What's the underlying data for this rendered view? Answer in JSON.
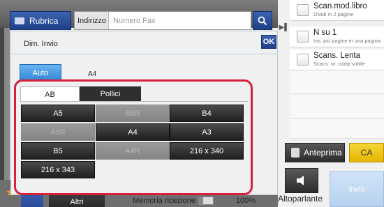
{
  "topbar": {
    "rubrica_label": "Rubrica",
    "indirizzo_label": "Indirizzo",
    "fax_placeholder": "Numero Fax"
  },
  "right_panel": {
    "options": [
      {
        "title": "Scan.mod.libro",
        "subtitle": "Dividi in 2 pagine"
      },
      {
        "title": "N su 1",
        "subtitle": "Ins. più pagine in una pagina"
      },
      {
        "title": "Scans. Lenta",
        "subtitle": "Scans. or. carta sottile"
      }
    ],
    "preview_label": "Anteprima",
    "ca_label": "CA",
    "speaker_label": "Altoparlante",
    "send_label": "Invio"
  },
  "dialog": {
    "title": "Dim. Invio",
    "ok_label": "OK",
    "auto_label": "Auto",
    "auto_value": "A4",
    "tabs": [
      "AB",
      "Pollici"
    ],
    "sizes": [
      {
        "label": "A5",
        "enabled": true
      },
      {
        "label": "B5R",
        "enabled": false
      },
      {
        "label": "B4",
        "enabled": true
      },
      {
        "label": "A5R",
        "enabled": false
      },
      {
        "label": "A4",
        "enabled": true
      },
      {
        "label": "A3",
        "enabled": true
      },
      {
        "label": "B5",
        "enabled": true
      },
      {
        "label": "A4R",
        "enabled": false
      },
      {
        "label": "216 x 340",
        "enabled": true
      },
      {
        "label": "216 x 343",
        "enabled": true
      }
    ]
  },
  "bottom": {
    "altri_label": "Altri",
    "memory_label": "Memoria ricezione",
    "memory_percent": "100%"
  },
  "colors": {
    "highlight": "#d8203a",
    "accent_blue": "#2f84d6",
    "ca_yellow": "#e6b400"
  }
}
